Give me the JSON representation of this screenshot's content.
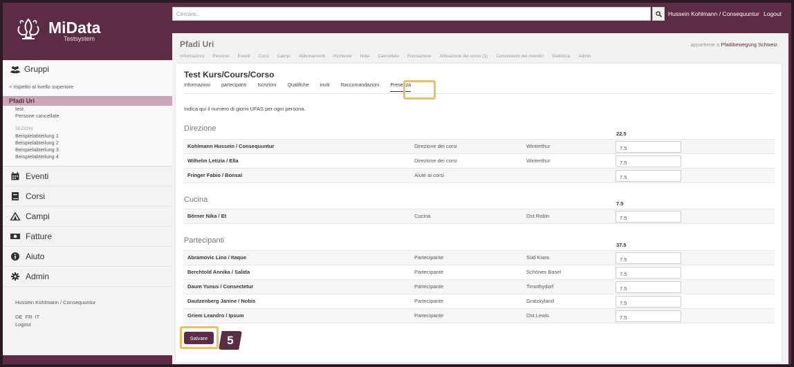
{
  "app": {
    "logo_title": "MiData",
    "logo_sub": "Testsystem"
  },
  "topbar": {
    "search_placeholder": "Cercare...",
    "user": "Hussein Kohlmann / Consequuntur",
    "logout": "Logout"
  },
  "sidebar": {
    "groups_label": "Gruppi",
    "back_link": "< rispetto al livello superiore",
    "active_group": "Pfadi Uri",
    "sub_items": [
      "test",
      "Persone cancellate"
    ],
    "sections_label": "SEZIONI",
    "sections": [
      "Beispielabteilung 1",
      "Beispielabteilung 2",
      "Beispielabteilung 3",
      "Beispielabteilung 4"
    ],
    "nav": [
      {
        "label": "Eventi",
        "icon": "calendar-icon"
      },
      {
        "label": "Corsi",
        "icon": "book-icon"
      },
      {
        "label": "Campi",
        "icon": "tent-icon"
      },
      {
        "label": "Fatture",
        "icon": "money-icon"
      },
      {
        "label": "Aiuto",
        "icon": "info-icon"
      },
      {
        "label": "Admin",
        "icon": "gear-icon"
      }
    ],
    "user": "Hussein Kohlmann / Consequuntur",
    "languages": "DE FR IT",
    "logout": "Logout"
  },
  "group": {
    "title": "Pfadi Uri",
    "belongs_prefix": "appartiene a",
    "belongs_link": "Pfadibewegung Schweiz",
    "tabs": [
      "Informazioni",
      "Persone",
      "Eventi",
      "Corsi",
      "Campi",
      "Abbonamenti",
      "Richieste",
      "Note",
      "Cancellato",
      "Formazione",
      "Attivazione del corso (1)",
      "Censimento dei membri",
      "Statistica",
      "Admin"
    ]
  },
  "course": {
    "title": "Test Kurs/Cours/Corso",
    "tabs": [
      "Informazioni",
      "partecipanti",
      "Iscrizioni",
      "Qualifiche",
      "inviti",
      "Raccomandazioni",
      "Presenza"
    ],
    "intro": "Indica qui il numero di giorni UFAS per ogni persona.",
    "sections": [
      {
        "title": "Direzione",
        "total": "22.5",
        "rows": [
          {
            "name": "Kohlmann Hussein / Consequuntur",
            "role": "Direzione dei corsi",
            "place": "Winterthur",
            "value": "7.5"
          },
          {
            "name": "Wilhelm Letizia / Ella",
            "role": "Direzione dei corsi",
            "place": "Winterthur",
            "value": "7.5"
          },
          {
            "name": "Fringer Fabio / Bonsai",
            "role": "Aiute ai corsi",
            "place": "",
            "value": "7.5"
          }
        ]
      },
      {
        "title": "Cucina",
        "total": "7.5",
        "rows": [
          {
            "name": "Börner Nika / Et",
            "role": "Cucina",
            "place": "Ost Robin",
            "value": "7.5"
          }
        ]
      },
      {
        "title": "Partecipanti",
        "total": "37.5",
        "rows": [
          {
            "name": "Abramovic Lino / Itaque",
            "role": "Partecipante",
            "place": "Süd Kiara",
            "value": "7.5"
          },
          {
            "name": "Berchtold Annika / Salida",
            "role": "Partecipante",
            "place": "Schönes Basel",
            "value": "7.5"
          },
          {
            "name": "Daum Yunus / Consectetur",
            "role": "Partecipante",
            "place": "Timothydorf",
            "value": "7.5"
          },
          {
            "name": "Dautzenberg Janine / Nobis",
            "role": "Partecipante",
            "place": "Gratzkyland",
            "value": "7.5"
          },
          {
            "name": "Griem Leandro / Ipsum",
            "role": "Partecipante",
            "place": "Ost Lewis",
            "value": "7.5"
          }
        ]
      }
    ],
    "save_label": "Salvare"
  },
  "annotation": {
    "step": "5",
    "highlight_color": "#e8c162"
  },
  "colors": {
    "brand": "#5b2c43",
    "active_nav": "#c9a7b8"
  }
}
